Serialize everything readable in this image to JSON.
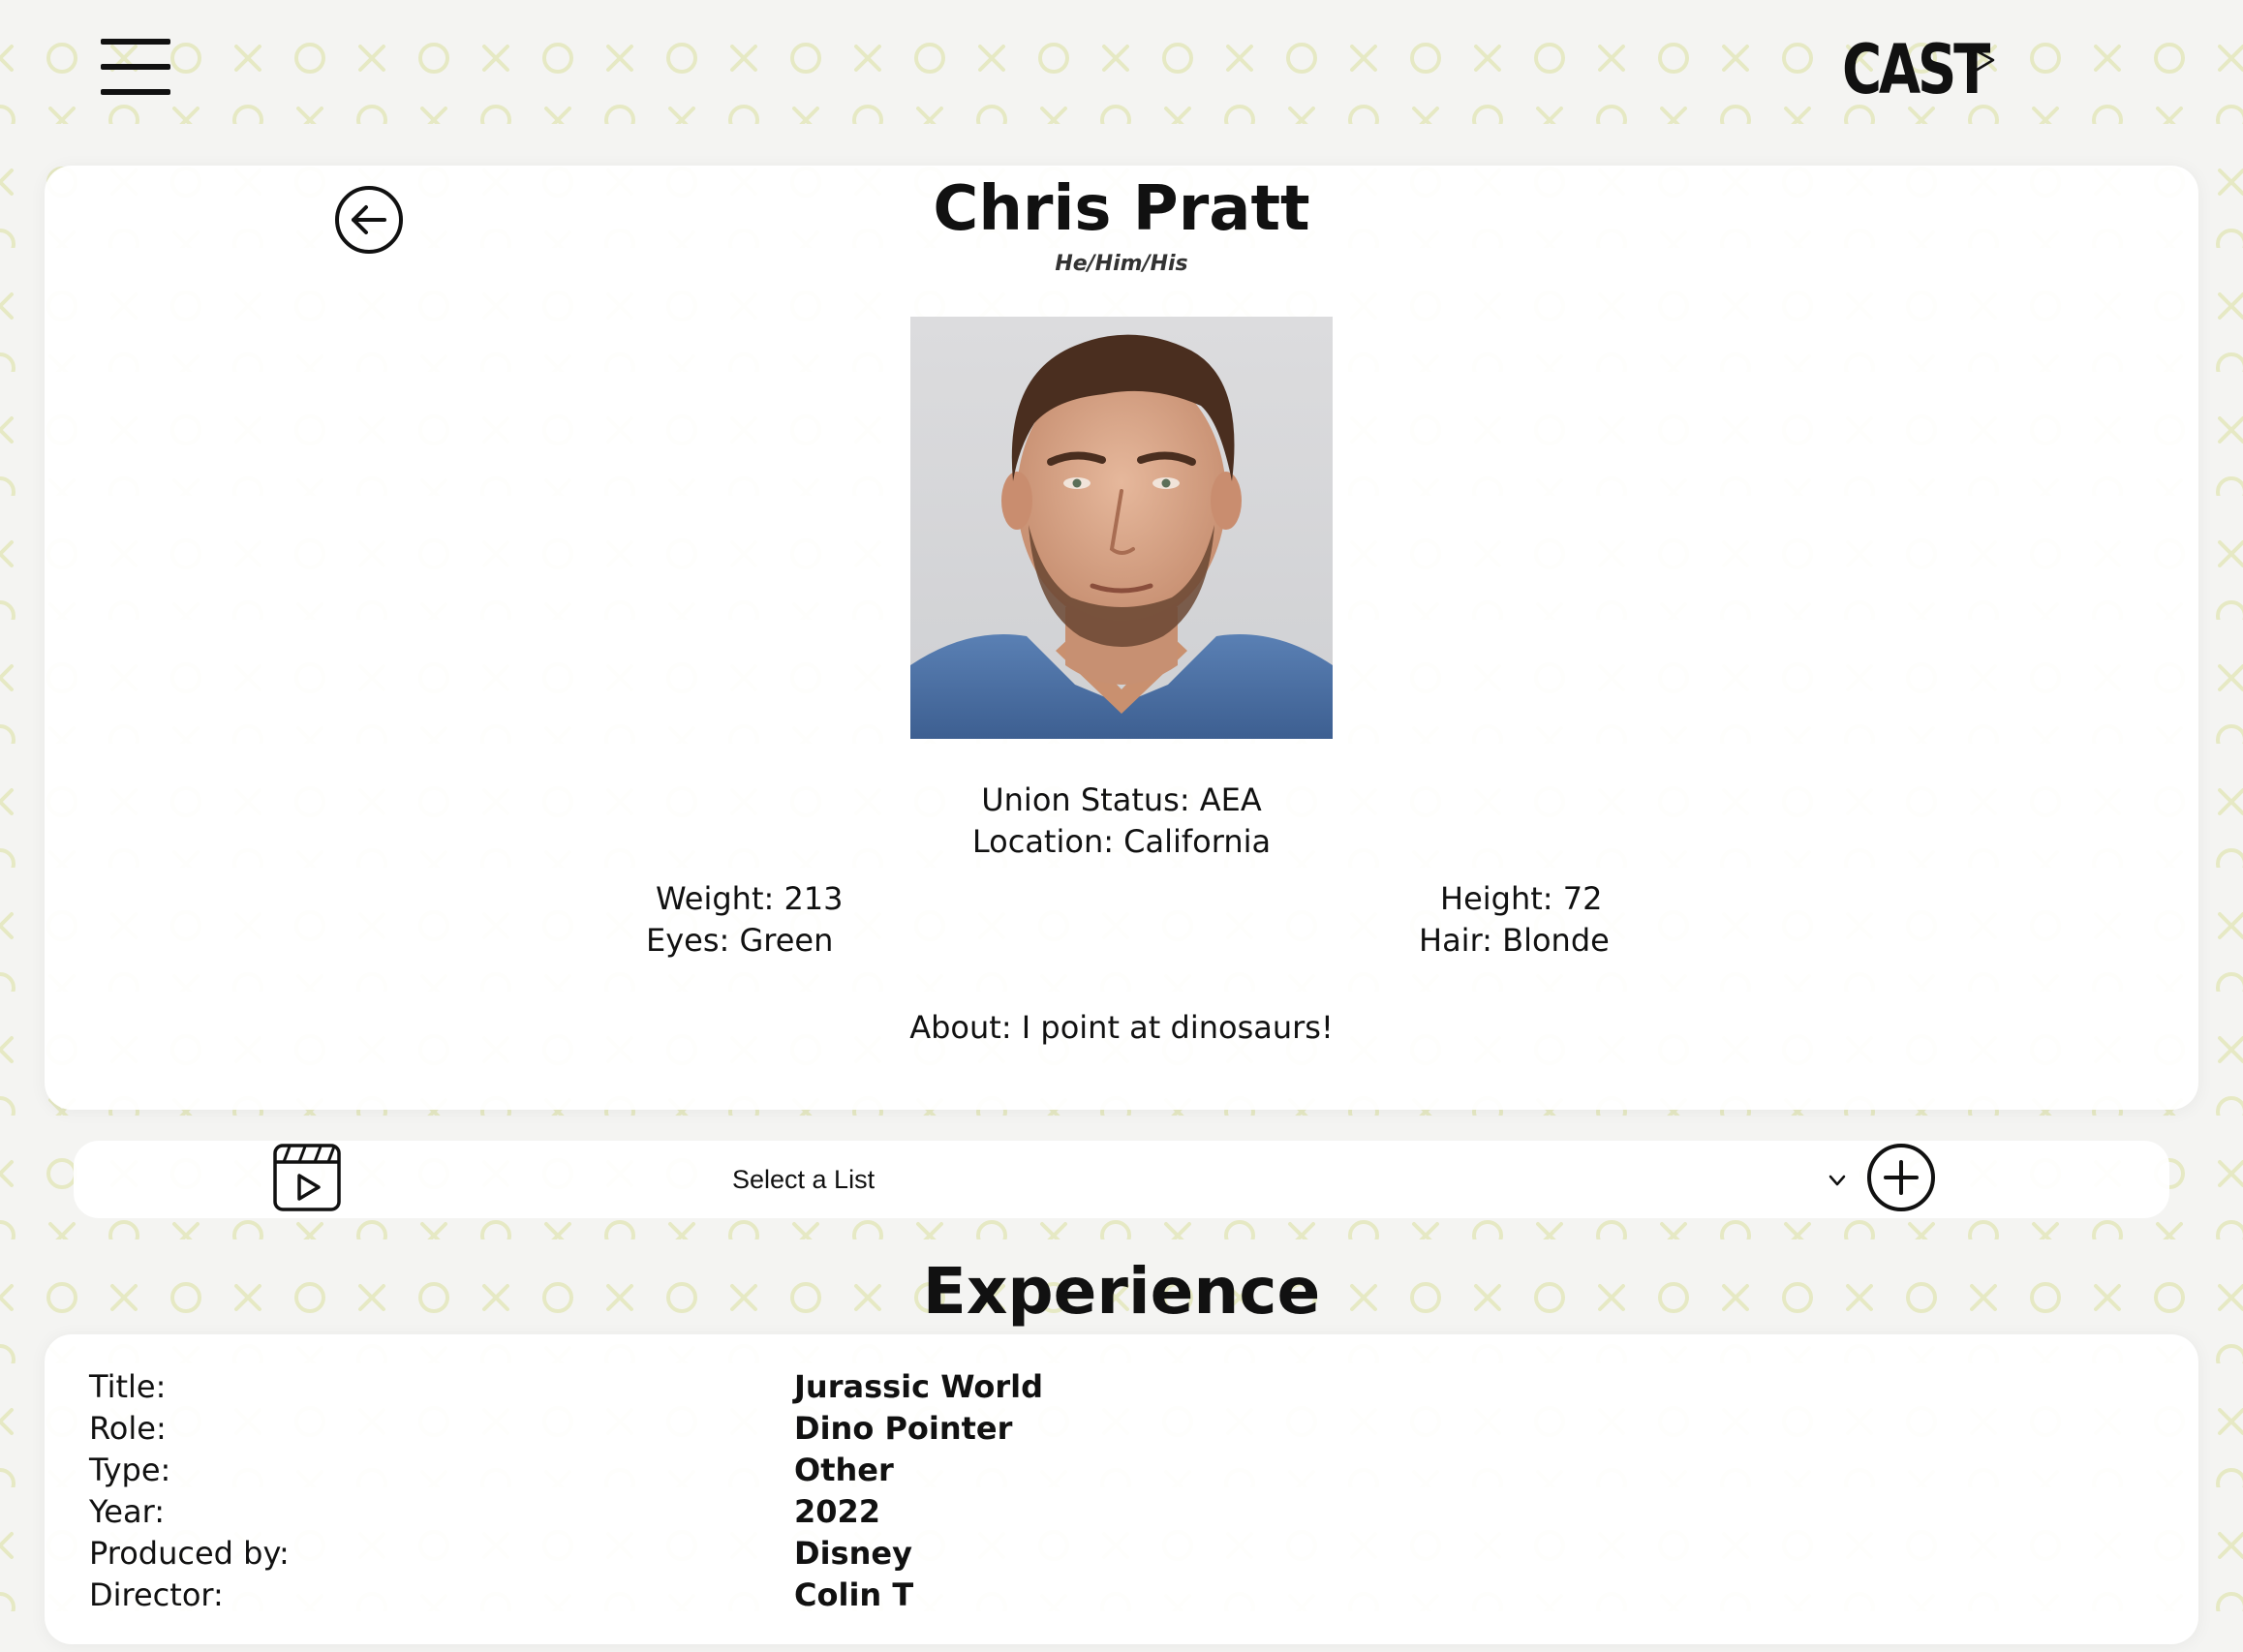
{
  "app": {
    "logo_text": "CAST"
  },
  "colors": {
    "background": "#f4f4f2",
    "pattern": "#e9ecc9",
    "card": "#ffffff",
    "text": "#111111"
  },
  "icons": {
    "menu": "hamburger-icon",
    "back": "arrow-left-circle-icon",
    "reel": "video-clapperboard-icon",
    "add": "plus-circle-icon",
    "dropdown": "chevron-down-icon",
    "logo_mark": "ticket-tag-icon"
  },
  "profile": {
    "name": "Chris Pratt",
    "pronouns": "He/Him/His",
    "union_status": "Union Status: AEA",
    "location": "Location: California",
    "weight": "Weight: 213",
    "eyes": "Eyes: Green",
    "height": "Height: 72",
    "hair": "Hair: Blonde",
    "about": "About: I point at dinosaurs!"
  },
  "list_bar": {
    "select_value": "Select a List"
  },
  "experience": {
    "heading": "Experience",
    "rows": [
      {
        "label": "Title:",
        "value": "Jurassic World"
      },
      {
        "label": "Role:",
        "value": "Dino Pointer"
      },
      {
        "label": "Type:",
        "value": "Other"
      },
      {
        "label": "Year:",
        "value": "2022"
      },
      {
        "label": "Produced by:",
        "value": "Disney"
      },
      {
        "label": "Director:",
        "value": "Colin T"
      }
    ]
  }
}
